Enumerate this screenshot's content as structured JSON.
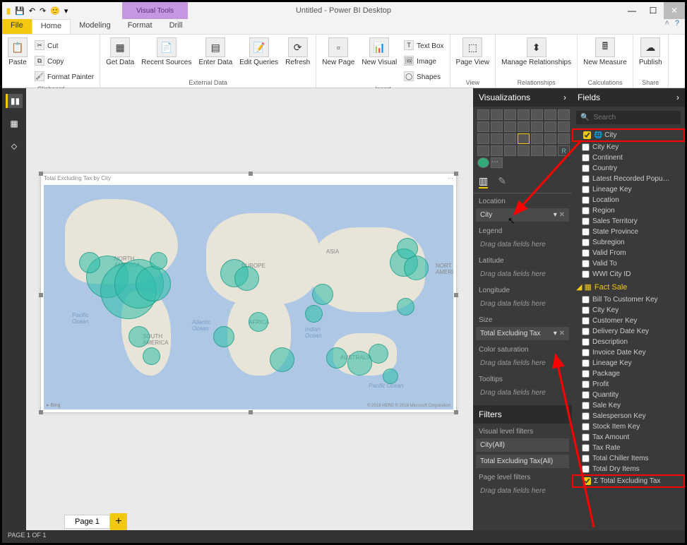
{
  "window": {
    "title": "Untitled - Power BI Desktop",
    "context_tool": "Visual Tools"
  },
  "tabs": {
    "file": "File",
    "home": "Home",
    "modeling": "Modeling",
    "format": "Format",
    "drill": "Drill"
  },
  "ribbon": {
    "clipboard": {
      "paste": "Paste",
      "cut": "Cut",
      "copy": "Copy",
      "painter": "Format Painter",
      "label": "Clipboard"
    },
    "external": {
      "getdata": "Get Data",
      "recent": "Recent Sources",
      "enter": "Enter Data",
      "edit": "Edit Queries",
      "refresh": "Refresh",
      "label": "External Data"
    },
    "insert": {
      "newpage": "New Page",
      "newvisual": "New Visual",
      "textbox": "Text Box",
      "image": "Image",
      "shapes": "Shapes",
      "label": "Insert"
    },
    "view": {
      "pageview": "Page View",
      "label": "View"
    },
    "rel": {
      "manage": "Manage Relationships",
      "label": "Relationships"
    },
    "calc": {
      "measure": "New Measure",
      "label": "Calculations"
    },
    "share": {
      "publish": "Publish",
      "label": "Share"
    }
  },
  "visual": {
    "title": "Total Excluding Tax by City",
    "bing": "Bing",
    "copyright": "© 2018 HERE © 2018 Microsoft Corporation"
  },
  "pages": {
    "page1": "Page 1",
    "status": "PAGE 1 OF 1"
  },
  "vizpane": {
    "header": "Visualizations",
    "wells": {
      "location": "Location",
      "location_val": "City",
      "legend": "Legend",
      "latitude": "Latitude",
      "longitude": "Longitude",
      "size": "Size",
      "size_val": "Total Excluding Tax",
      "colorsat": "Color saturation",
      "tooltips": "Tooltips",
      "drag": "Drag data fields here"
    },
    "filters": {
      "header": "Filters",
      "visual": "Visual level filters",
      "city": "City(All)",
      "tet": "Total Excluding Tax(All)",
      "page": "Page level filters"
    }
  },
  "fieldspane": {
    "header": "Fields",
    "search": "Search",
    "table1": "Fact Sale",
    "dim_fields": [
      "City",
      "City Key",
      "Continent",
      "Country",
      "Latest Recorded Popu…",
      "Lineage Key",
      "Location",
      "Region",
      "Sales Territory",
      "State Province",
      "Subregion",
      "Valid From",
      "Valid To",
      "WWI City ID"
    ],
    "fact_fields": [
      "Bill To Customer Key",
      "City Key",
      "Customer Key",
      "Delivery Date Key",
      "Description",
      "Invoice Date Key",
      "Lineage Key",
      "Package",
      "Profit",
      "Quantity",
      "Sale Key",
      "Salesperson Key",
      "Stock Item Key",
      "Tax Amount",
      "Tax Rate",
      "Total Chiller Items",
      "Total Dry Items",
      "Total Excluding Tax"
    ]
  }
}
